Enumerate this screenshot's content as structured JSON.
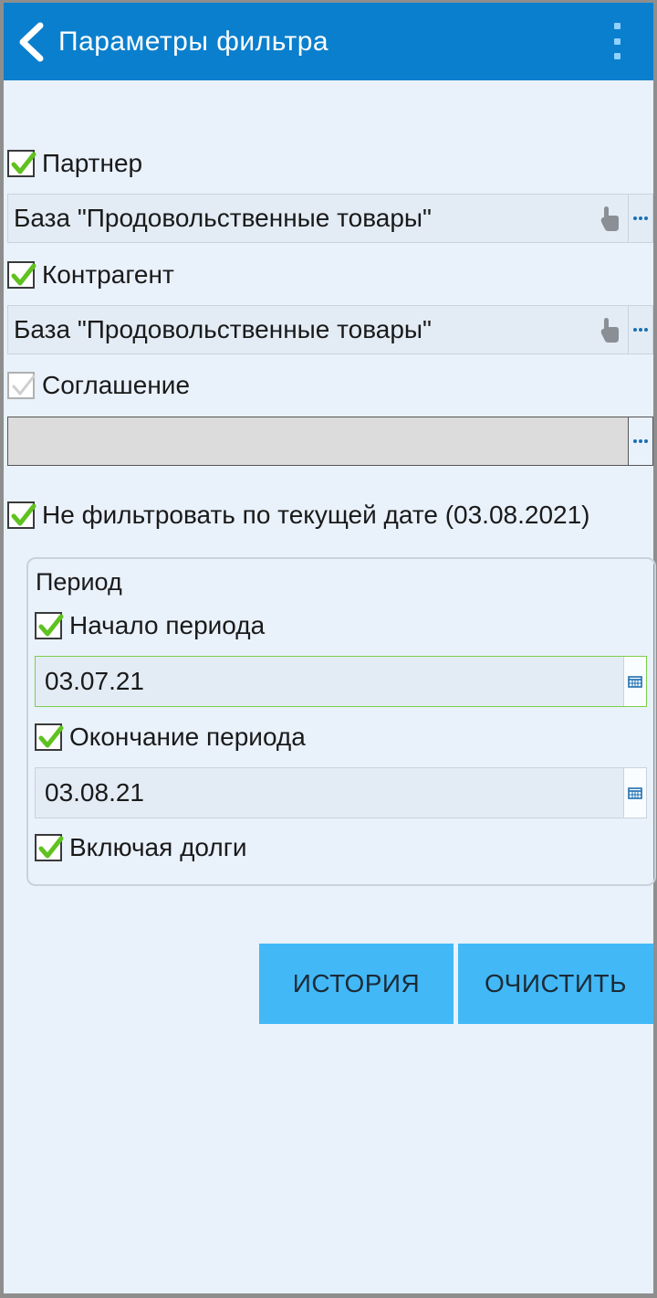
{
  "header": {
    "title": "Параметры фильтра"
  },
  "filters": {
    "partner": {
      "label": "Партнер",
      "checked": true,
      "value": "База \"Продовольственные товары\""
    },
    "counterparty": {
      "label": "Контрагент",
      "checked": true,
      "value": "База \"Продовольственные товары\""
    },
    "agreement": {
      "label": "Соглашение",
      "checked": false,
      "value": ""
    },
    "no_date_filter": {
      "label": "Не фильтровать по текущей дате (03.08.2021)",
      "checked": true
    }
  },
  "period": {
    "title": "Период",
    "start": {
      "label": "Начало периода",
      "checked": true,
      "value": "03.07.21"
    },
    "end": {
      "label": "Окончание периода",
      "checked": true,
      "value": "03.08.21"
    },
    "include_debts": {
      "label": "Включая долги",
      "checked": true
    }
  },
  "buttons": {
    "history": "ИСТОРИЯ",
    "clear": "ОЧИСТИТЬ"
  },
  "colors": {
    "header_bg": "#0a7fcd",
    "button_bg": "#42b8f7",
    "check_green": "#5fc21f",
    "page_bg": "#e9f1fb"
  }
}
